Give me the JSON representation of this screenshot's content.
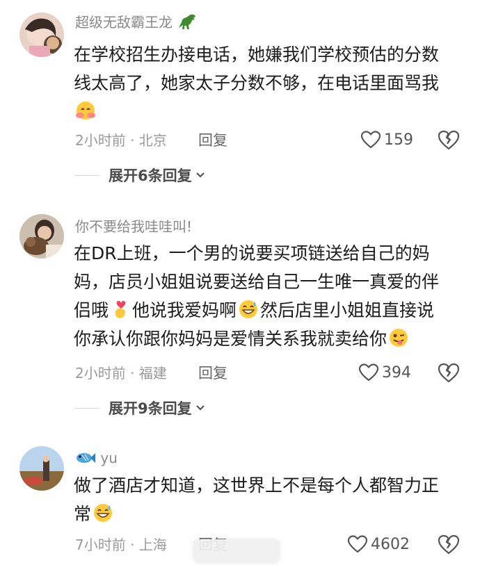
{
  "comments": [
    {
      "username": "超级无敌霸王龙",
      "username_badge": "dinosaur-icon",
      "lines": [
        "在学校招生办接电话，她嫌我们学校预估的分数",
        "线太高了，她家太子分数不够，在电话里面骂我"
      ],
      "time_location": "2小时前 · 北京",
      "reply_label": "回复",
      "likes": "159",
      "expand_label": "展开6条回复"
    },
    {
      "username": "你不要给我哇哇叫!",
      "lines": [
        "在DR上班，一个男的说要买项链送给自己的妈",
        "妈，店员小姐姐说要送给自己一生唯一真爱的伴",
        "侣哦",
        "他说我爱妈啊",
        "然后店里小姐姐直接说",
        "你承认你跟你妈妈是爱情关系我就卖给你"
      ],
      "time_location": "2小时前 · 福建",
      "reply_label": "回复",
      "likes": "394",
      "expand_label": "展开9条回复"
    },
    {
      "username": "yu",
      "username_badge": "fish-icon",
      "lines": [
        "做了酒店才知道，这世界上不是每个人都智力正",
        "常"
      ],
      "time_location": "7小时前 · 上海",
      "reply_label": "回复",
      "likes": "4602"
    }
  ],
  "colors": {
    "text": "#1c1c1c",
    "secondary": "#9a9a9a",
    "icon": "#555555"
  }
}
